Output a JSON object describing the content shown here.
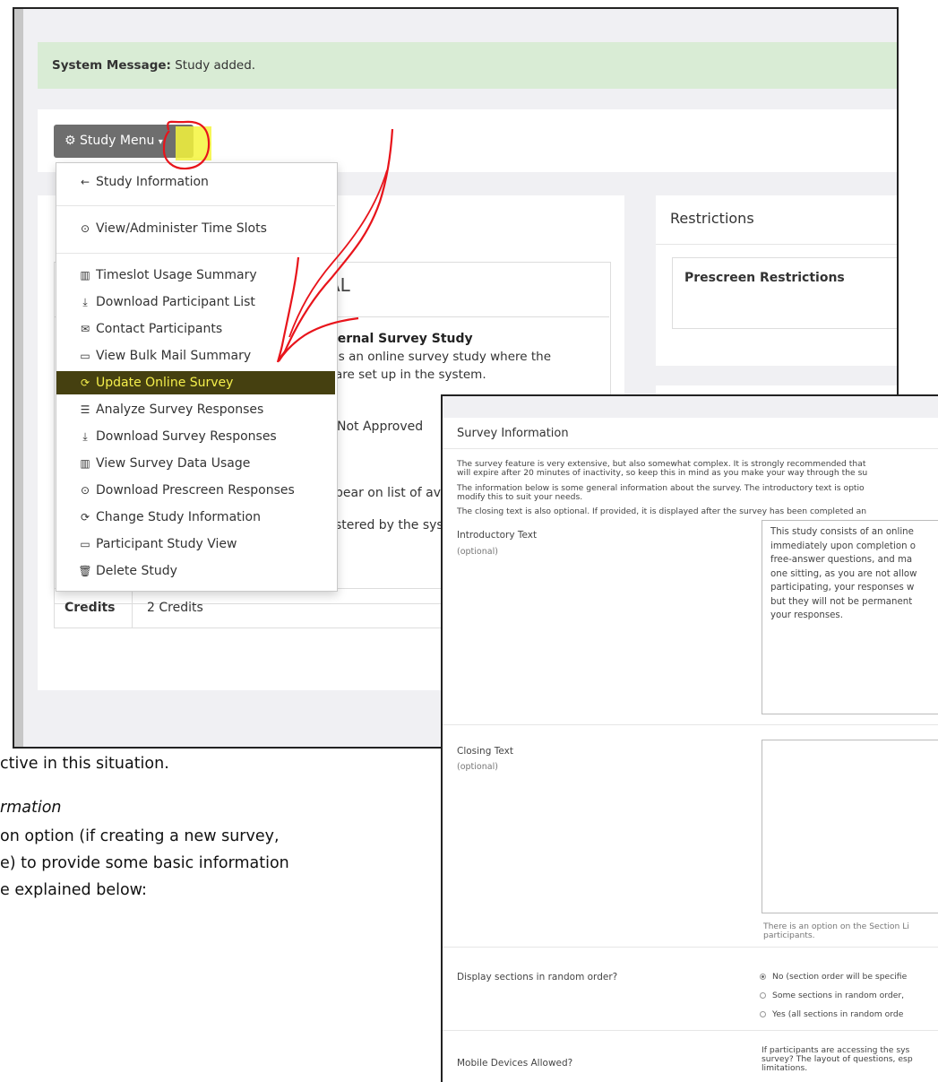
{
  "screen1": {
    "system_message_label": "System Message:",
    "system_message_text": " Study added.",
    "study_menu_label": "Study Menu",
    "menu_items": [
      {
        "label": "Study Information",
        "icon": "arrow-left-icon",
        "glyph": "←"
      },
      {
        "label": "View/Administer Time Slots",
        "icon": "clock-icon",
        "glyph": "⊙"
      },
      {
        "label": "Timeslot Usage Summary",
        "icon": "bar-chart-icon",
        "glyph": "▥"
      },
      {
        "label": "Download Participant List",
        "icon": "download-icon",
        "glyph": "⤓"
      },
      {
        "label": "Contact Participants",
        "icon": "envelope-icon",
        "glyph": "✉"
      },
      {
        "label": "View Bulk Mail Summary",
        "icon": "inbox-icon",
        "glyph": "▭"
      },
      {
        "label": "Update Online Survey",
        "icon": "refresh-icon",
        "glyph": "⟳"
      },
      {
        "label": "Analyze Survey Responses",
        "icon": "list-icon",
        "glyph": "☰"
      },
      {
        "label": "Download Survey Responses",
        "icon": "download-icon",
        "glyph": "⤓"
      },
      {
        "label": "View Survey Data Usage",
        "icon": "bar-chart-icon",
        "glyph": "▥"
      },
      {
        "label": "Download Prescreen Responses",
        "icon": "circle-down-icon",
        "glyph": "⊙"
      },
      {
        "label": "Change Study Information",
        "icon": "refresh-icon",
        "glyph": "⟳"
      },
      {
        "label": "Participant Study View",
        "icon": "laptop-icon",
        "glyph": "▭"
      },
      {
        "label": "Delete Study",
        "icon": "trash-icon",
        "glyph": "🗑"
      }
    ],
    "panel_fragment_al": "AL",
    "study_type_fragment": "ternal Survey Study",
    "desc_line1_fragment": "is an online survey study where the",
    "desc_line2_fragment": "are set up in the system.",
    "approval_fragment": "Not Approved",
    "listing_fragment": "pear on list of ava",
    "admin_fragment": "stered by the syst",
    "credits_label": "Credits",
    "credits_value": "2 Credits",
    "restrictions_title": "Restrictions",
    "prescreen_title": "Prescreen Restrictions"
  },
  "document": {
    "line1": "ctive in this situation.",
    "line2": "rmation",
    "line3": "on option (if creating a new survey,",
    "line4": "e) to provide some basic information",
    "line5": "e explained below:"
  },
  "screen2": {
    "title": "Survey Information",
    "para1a": "The survey feature is very extensive, but also somewhat complex. It is strongly recommended that",
    "para1b": "will expire after 20 minutes of inactivity, so keep this in mind as you make your way through the su",
    "para2a": "The information below is some general information about the survey. The introductory text is optio",
    "para2b": "modify this to suit your needs.",
    "para3": "The closing text is also optional. If provided, it is displayed after the survey has been completed an",
    "intro_label": "Introductory Text",
    "intro_optional": "(optional)",
    "intro_text_lines": [
      "This study consists of an online",
      "immediately upon completion o",
      "free-answer questions, and ma",
      "one sitting, as you are not allow",
      "participating, your responses w",
      "but they will not be permanent",
      "your responses."
    ],
    "closing_label": "Closing Text",
    "closing_optional": "(optional)",
    "section_note_a": "There is an option on the Section Li",
    "section_note_b": "participants.",
    "random_label": "Display sections in random order?",
    "random_options": [
      {
        "label": "No (section order will be specifie",
        "selected": true
      },
      {
        "label": "Some sections in random order,",
        "selected": false
      },
      {
        "label": "Yes (all sections in random orde",
        "selected": false
      }
    ],
    "mobile_label": "Mobile Devices Allowed?",
    "mobile_help_a": "If participants are accessing the sys",
    "mobile_help_b": "survey? The layout of questions, esp",
    "mobile_help_c": "limitations."
  },
  "colors": {
    "system_message_bg": "#d9ecd5",
    "highlight_yellow": "#f4f43c",
    "active_item_bg": "#454010",
    "annotation_red": "#e8141b"
  }
}
